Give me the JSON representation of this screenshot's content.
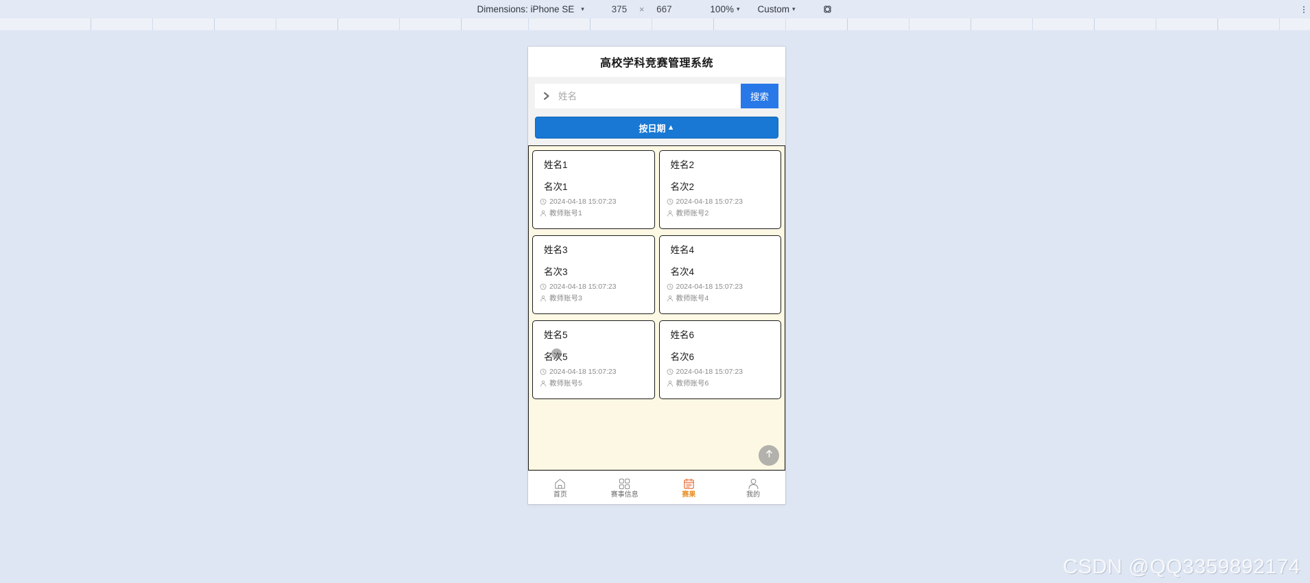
{
  "devtools": {
    "dimensions_label": "Dimensions: iPhone SE",
    "width": "375",
    "times": "×",
    "height": "667",
    "zoom": "100%",
    "throttling": "Custom",
    "rotate_icon": "rotate-device-icon",
    "more_icon": "more-options-icon",
    "caret": "▾"
  },
  "app": {
    "title": "高校学科竞赛管理系统",
    "search": {
      "placeholder": "姓名",
      "value": "",
      "icon": "chevron-right-icon",
      "button_label": "搜索"
    },
    "sort": {
      "label": "按日期",
      "arrow": "▲"
    },
    "cards": [
      {
        "name": "姓名1",
        "rank": "名次1",
        "time": "2024-04-18 15:07:23",
        "teacher": "教师账号1",
        "time_icon": "clock-icon",
        "teacher_icon": "person-icon"
      },
      {
        "name": "姓名2",
        "rank": "名次2",
        "time": "2024-04-18 15:07:23",
        "teacher": "教师账号2",
        "time_icon": "clock-icon",
        "teacher_icon": "person-icon"
      },
      {
        "name": "姓名3",
        "rank": "名次3",
        "time": "2024-04-18 15:07:23",
        "teacher": "教师账号3",
        "time_icon": "clock-icon",
        "teacher_icon": "person-icon"
      },
      {
        "name": "姓名4",
        "rank": "名次4",
        "time": "2024-04-18 15:07:23",
        "teacher": "教师账号4",
        "time_icon": "clock-icon",
        "teacher_icon": "person-icon"
      },
      {
        "name": "姓名5",
        "rank": "名次5",
        "time": "2024-04-18 15:07:23",
        "teacher": "教师账号5",
        "time_icon": "clock-icon",
        "teacher_icon": "person-icon"
      },
      {
        "name": "姓名6",
        "rank": "名次6",
        "time": "2024-04-18 15:07:23",
        "teacher": "教师账号6",
        "time_icon": "clock-icon",
        "teacher_icon": "person-icon"
      }
    ],
    "scroll_top_icon": "arrow-up-icon",
    "tabs": [
      {
        "label": "首页",
        "icon": "home-icon",
        "active": false
      },
      {
        "label": "赛事信息",
        "icon": "grid-icon",
        "active": false
      },
      {
        "label": "赛果",
        "icon": "calendar-icon",
        "active": true
      },
      {
        "label": "我的",
        "icon": "person-icon",
        "active": false
      }
    ]
  },
  "watermark": "CSDN @QQ3359892174",
  "colors": {
    "accent_blue": "#2878e8",
    "sort_blue": "#1878d4",
    "active_orange": "#e8912a",
    "list_bg": "#fdf8e3",
    "page_bg": "#dfe6f3"
  }
}
